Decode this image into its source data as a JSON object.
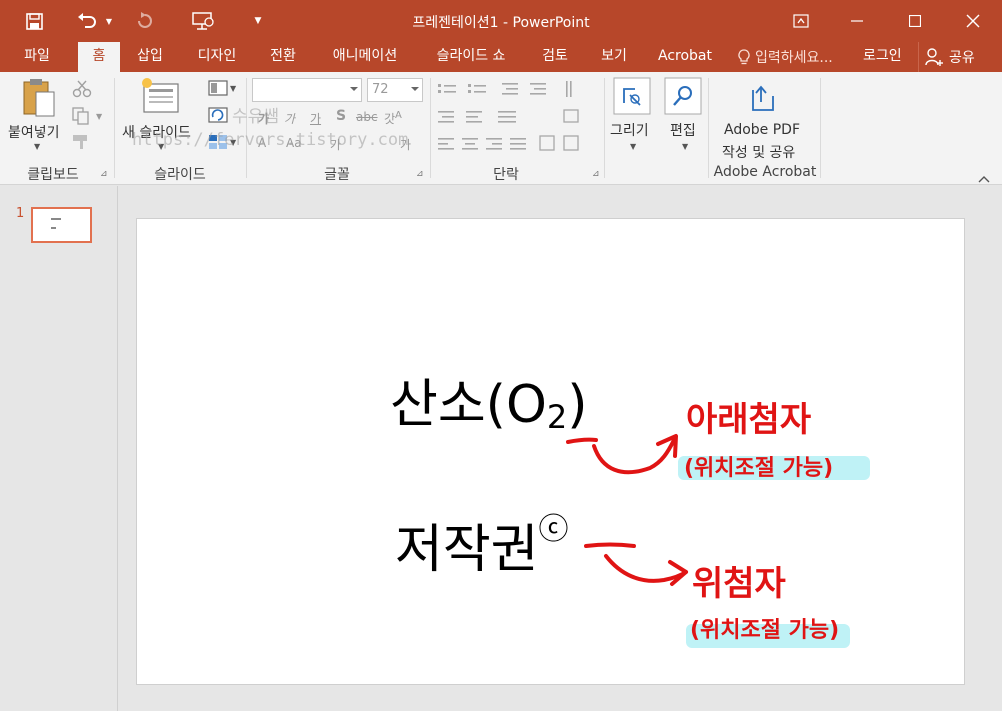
{
  "window": {
    "title": "프레젠테이션1 - PowerPoint",
    "accent": "#b7472a"
  },
  "tabs": [
    {
      "label": "파일",
      "active": false
    },
    {
      "label": "홈",
      "active": true
    },
    {
      "label": "삽입",
      "active": false
    },
    {
      "label": "디자인",
      "active": false
    },
    {
      "label": "전환",
      "active": false
    },
    {
      "label": "애니메이션",
      "active": false
    },
    {
      "label": "슬라이드 쇼",
      "active": false
    },
    {
      "label": "검토",
      "active": false
    },
    {
      "label": "보기",
      "active": false
    },
    {
      "label": "Acrobat",
      "active": false
    }
  ],
  "tell_me": "입력하세요...",
  "login": "로그인",
  "share": "공유",
  "ribbon": {
    "clipboard": {
      "paste": "붙여넣기",
      "group": "클립보드"
    },
    "slides": {
      "new_slide": "새 슬라이드",
      "group": "슬라이드"
    },
    "font": {
      "size": "72",
      "group": "글꼴"
    },
    "paragraph": {
      "group": "단락"
    },
    "drawing": {
      "label": "그리기"
    },
    "editing": {
      "label": "편집"
    },
    "acrobat": {
      "line1": "Adobe PDF",
      "line2": "작성 및 공유",
      "group": "Adobe Acrobat"
    }
  },
  "watermark": {
    "line1": "수유쌤",
    "line2": "https://fervors.tistory.com"
  },
  "thumbnails": [
    {
      "number": "1"
    }
  ],
  "slide": {
    "line1_main": "산소(O",
    "line1_sub": "2",
    "line1_end": ")",
    "line2_main": "저작권",
    "line2_sup": "ⓒ"
  },
  "annotations": {
    "subscript_title": "아래첨자",
    "subscript_note": "(위치조절 가능)",
    "superscript_title": "위첨자",
    "superscript_note": "(위치조절 가능)"
  }
}
